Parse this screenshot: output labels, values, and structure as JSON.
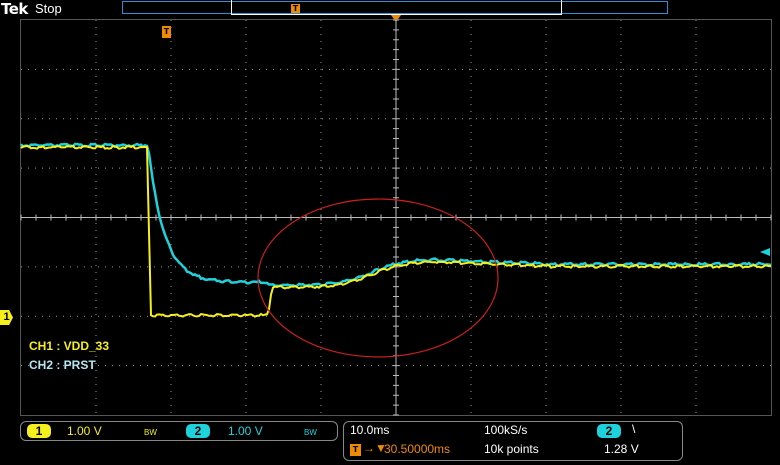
{
  "header": {
    "brand": "Tek",
    "status": "Stop",
    "trigger_marker": "T"
  },
  "channels": {
    "ch1_label": "CH1 : VDD_33",
    "ch2_label": "CH2 : PRST",
    "ch1_marker": "1"
  },
  "colors": {
    "ch1": "#f5ef1e",
    "ch2": "#1ed2dc",
    "trigger": "#f08a00",
    "annotation": "#c8201e",
    "grid": "#9a9a9a"
  },
  "footer": {
    "ch1": {
      "num": "1",
      "scale": "1.00 V",
      "bw": "BW"
    },
    "ch2": {
      "num": "2",
      "scale": "1.00 V",
      "bw": "BW"
    },
    "timebase": "10.0ms",
    "sample_rate": "100kS/s",
    "trigger_pos": "30.50000ms",
    "record_length": "10k points",
    "trig_source": "2",
    "trig_slope": "\\",
    "trig_level": "1.28 V"
  }
}
